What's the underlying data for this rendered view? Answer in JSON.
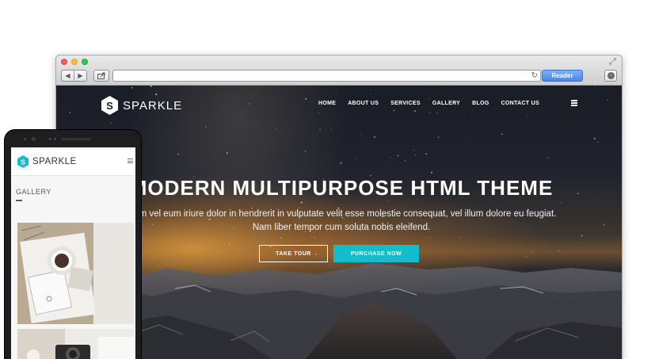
{
  "browser": {
    "reader_label": "Reader",
    "address": ""
  },
  "site": {
    "logo_letter": "S",
    "logo_text": "SPARKLE",
    "nav": [
      "HOME",
      "ABOUT US",
      "SERVICES",
      "GALLERY",
      "BLOG",
      "CONTACT US"
    ],
    "hero_title": "MODERN MULTIPURPOSE HTML THEME",
    "hero_line1": "utem vel eum iriure dolor in hendrerit in vulputate velit esse molestie consequat, vel illum dolore eu feugiat.",
    "hero_line2": "Nam liber tempor cum soluta nobis eleifend.",
    "btn_tour": "TAKE TOUR",
    "btn_purchase": "PURCHASE NOW"
  },
  "mobile": {
    "logo_letter": "S",
    "logo_text": "SPARKLE",
    "section_title": "GALLERY"
  },
  "colors": {
    "accent": "#15bccc",
    "reader_blue": "#4a86e8"
  },
  "icons": [
    "back-arrow-icon",
    "forward-arrow-icon",
    "share-icon",
    "reload-icon",
    "download-icon",
    "fullscreen-icon",
    "menu-icon",
    "logo-hexagon-icon"
  ]
}
